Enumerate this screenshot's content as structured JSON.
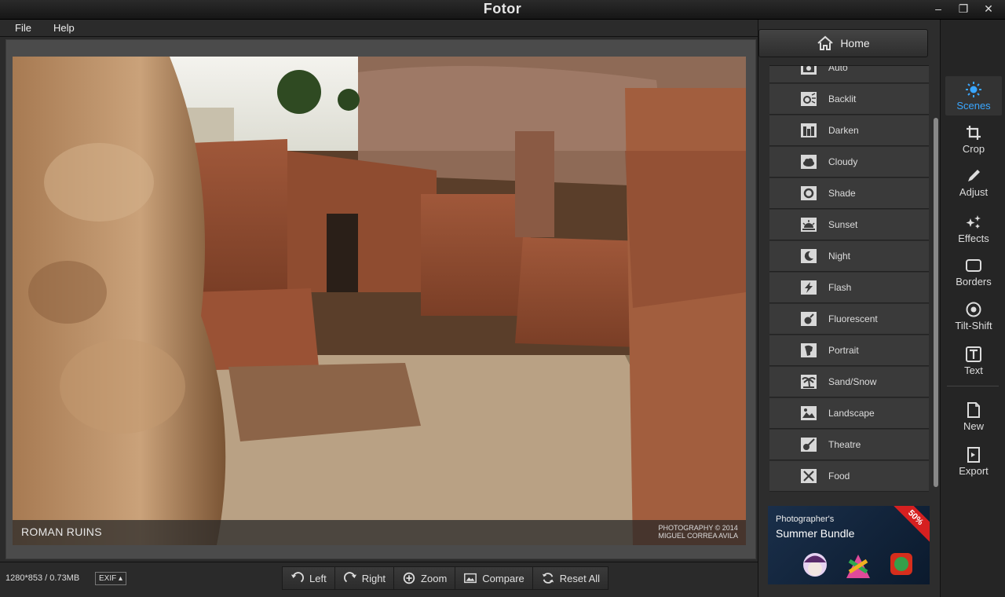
{
  "window": {
    "title": "Fotor"
  },
  "menu": {
    "file": "File",
    "help": "Help"
  },
  "photo": {
    "caption": "ROMAN RUINS",
    "credit_line1": "PHOTOGRAPHY © 2014",
    "credit_line2": "MIGUEL CORREA AVILA"
  },
  "status": {
    "dimensions": "1280*853 / 0.73MB",
    "exif": "EXIF ▴"
  },
  "toolbar": {
    "left": "Left",
    "right": "Right",
    "zoom": "Zoom",
    "compare": "Compare",
    "reset": "Reset All"
  },
  "panel": {
    "home": "Home"
  },
  "scenes": [
    "Auto",
    "Backlit",
    "Darken",
    "Cloudy",
    "Shade",
    "Sunset",
    "Night",
    "Flash",
    "Fluorescent",
    "Portrait",
    "Sand/Snow",
    "Landscape",
    "Theatre",
    "Food"
  ],
  "ad": {
    "line1": "Photographer's",
    "line2": "Summer Bundle",
    "badge": "50%"
  },
  "nav": {
    "scenes": "Scenes",
    "crop": "Crop",
    "adjust": "Adjust",
    "effects": "Effects",
    "borders": "Borders",
    "tiltshift": "Tilt-Shift",
    "text": "Text",
    "new": "New",
    "export": "Export"
  },
  "colors": {
    "accent": "#3aa6ff",
    "badge": "#d62020"
  }
}
